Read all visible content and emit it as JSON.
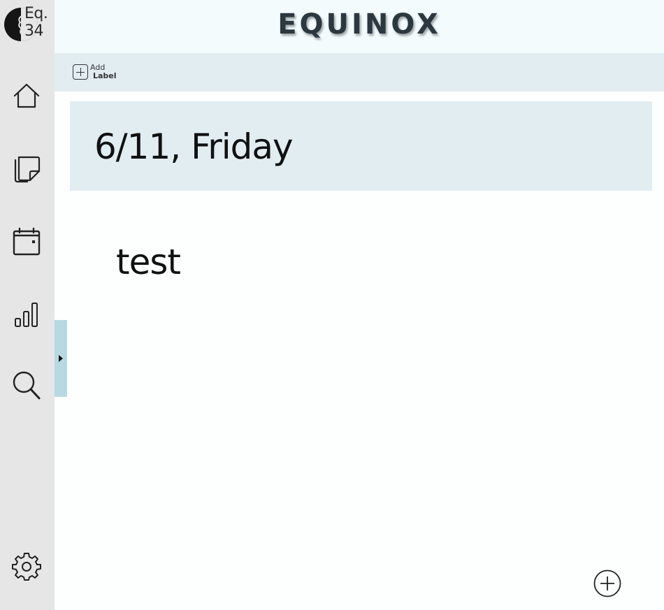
{
  "app": {
    "title": "EQUINOX",
    "logo": {
      "line1": "Eq.",
      "line2": "34"
    }
  },
  "sidebar": {
    "items": [
      {
        "icon": "home-icon"
      },
      {
        "icon": "notes-icon"
      },
      {
        "icon": "calendar-icon"
      },
      {
        "icon": "stats-icon"
      },
      {
        "icon": "search-icon"
      }
    ],
    "settings_icon": "gear-icon"
  },
  "toolbar": {
    "add_label_line1": "Add",
    "add_label_line2": "Label"
  },
  "entry": {
    "date_title": "6/11, Friday",
    "body": "test"
  },
  "colors": {
    "sidebar_bg": "#e6e6e6",
    "header_bg": "#f3fbfc",
    "banner_bg": "#e2edf2",
    "collapse_tab": "#b8d9e2",
    "title_text": "#2b3840"
  }
}
